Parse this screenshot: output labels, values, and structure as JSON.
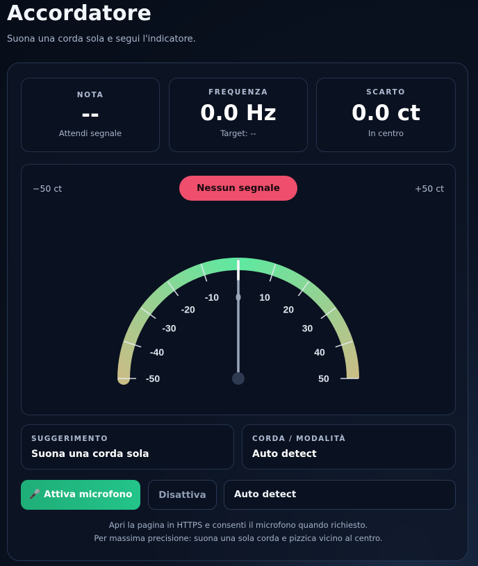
{
  "header": {
    "title": "Accordatore",
    "subtitle": "Suona una corda sola e segui l'indicatore."
  },
  "stats": {
    "note": {
      "label": "NOTA",
      "value": "--",
      "sub": "Attendi segnale"
    },
    "frequency": {
      "label": "FREQUENZA",
      "value": "0.0 Hz",
      "sub": "Target: --"
    },
    "offset": {
      "label": "SCARTO",
      "value": "0.0 ct",
      "sub": "In centro"
    }
  },
  "gauge": {
    "range_min_label": "−50 ct",
    "range_max_label": "+50 ct",
    "status": "Nessun segnale",
    "needle_cents": 0,
    "min": -50,
    "max": 50,
    "tick_labels": [
      "-50",
      "-40",
      "-30",
      "-20",
      "-10",
      "10",
      "20",
      "30",
      "40",
      "50"
    ],
    "colors": {
      "center": "#5ee8a0",
      "edge": "#c9bd86",
      "status": "#ef4f6c"
    }
  },
  "info": {
    "suggestion": {
      "label": "SUGGERIMENTO",
      "value": "Suona una corda sola"
    },
    "mode": {
      "label": "CORDA / MODALITÀ",
      "value": "Auto detect"
    }
  },
  "controls": {
    "activate_label": "Attiva microfono",
    "activate_icon": "microphone-icon",
    "deactivate_label": "Disattiva",
    "mode_select_value": "Auto detect"
  },
  "footer": {
    "line1": "Apri la pagina in HTTPS e consenti il microfono quando richiesto.",
    "line2": "Per massima precisione: suona una sola corda e pizzica vicino al centro."
  }
}
